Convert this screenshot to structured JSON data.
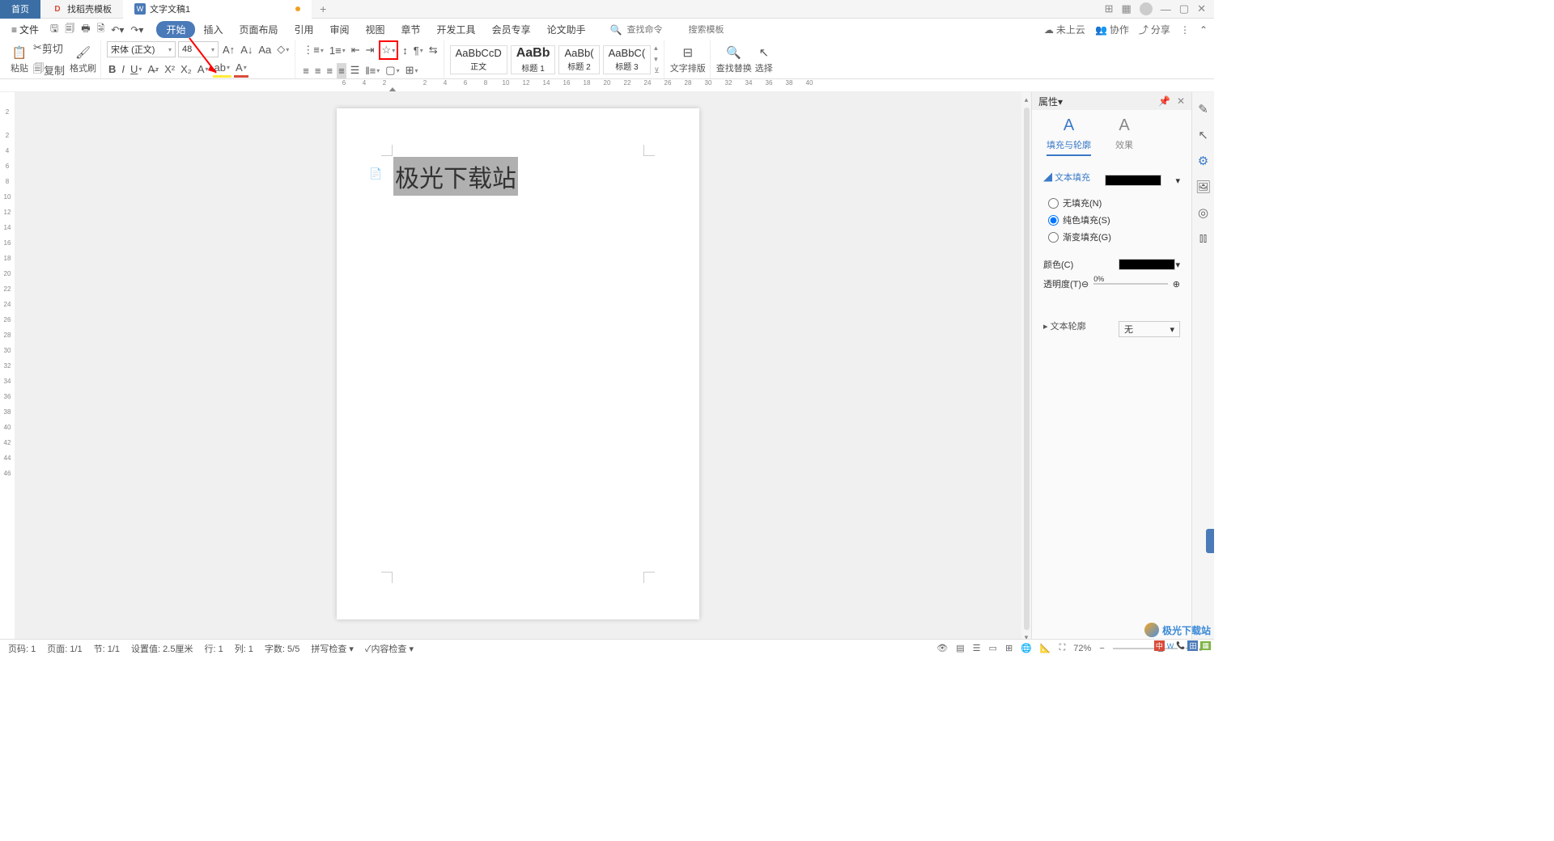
{
  "titlebar": {
    "home": "首页",
    "template_tab": "找稻壳模板",
    "doc_tab": "文字文稿1",
    "modified": true
  },
  "menubar": {
    "file": "文件",
    "tabs": [
      "开始",
      "插入",
      "页面布局",
      "引用",
      "审阅",
      "视图",
      "章节",
      "开发工具",
      "会员专享",
      "论文助手"
    ],
    "active_tab": 0,
    "search_cmd_placeholder": "查找命令",
    "search_tpl_placeholder": "搜索模板",
    "not_uploaded": "未上云",
    "collab": "协作",
    "share": "分享"
  },
  "ribbon": {
    "paste": "粘贴",
    "cut": "剪切",
    "copy": "复制",
    "format_painter": "格式刷",
    "font_name": "宋体 (正文)",
    "font_size": "48",
    "styles": [
      {
        "preview": "AaBbCcD",
        "name": "正文"
      },
      {
        "preview": "AaBb",
        "name": "标题 1"
      },
      {
        "preview": "AaBb(",
        "name": "标题 2"
      },
      {
        "preview": "AaBbC(",
        "name": "标题 3"
      }
    ],
    "text_layout": "文字排版",
    "find_replace": "查找替换",
    "select": "选择"
  },
  "ruler_ticks": [
    "6",
    "4",
    "2",
    "2",
    "4",
    "6",
    "8",
    "10",
    "12",
    "14",
    "16",
    "18",
    "20",
    "22",
    "24",
    "26",
    "28",
    "30",
    "32",
    "34",
    "36",
    "38",
    "40"
  ],
  "ruler_v": [
    "2",
    "2",
    "4",
    "6",
    "8",
    "10",
    "12",
    "14",
    "16",
    "18",
    "20",
    "22",
    "24",
    "26",
    "28",
    "30",
    "32",
    "34",
    "36",
    "38",
    "40",
    "42",
    "44",
    "46"
  ],
  "document": {
    "selected_text": "极光下载站"
  },
  "panel": {
    "title": "属性",
    "tab_fill": "填充与轮廓",
    "tab_effect": "效果",
    "section_fill": "文本填充",
    "no_fill": "无填充(N)",
    "solid_fill": "纯色填充(S)",
    "gradient_fill": "渐变填充(G)",
    "color_label": "颜色(C)",
    "opacity_label": "透明度(T)",
    "opacity_value": "0%",
    "outline_section": "文本轮廓",
    "outline_value": "无"
  },
  "statusbar": {
    "page_no": "页码: 1",
    "page": "页面: 1/1",
    "section": "节: 1/1",
    "indent": "设置值: 2.5厘米",
    "row": "行: 1",
    "col": "列: 1",
    "chars": "字数: 5/5",
    "spell": "拼写检查",
    "content": "内容检查",
    "zoom": "72%"
  },
  "watermark": "极光下载站"
}
